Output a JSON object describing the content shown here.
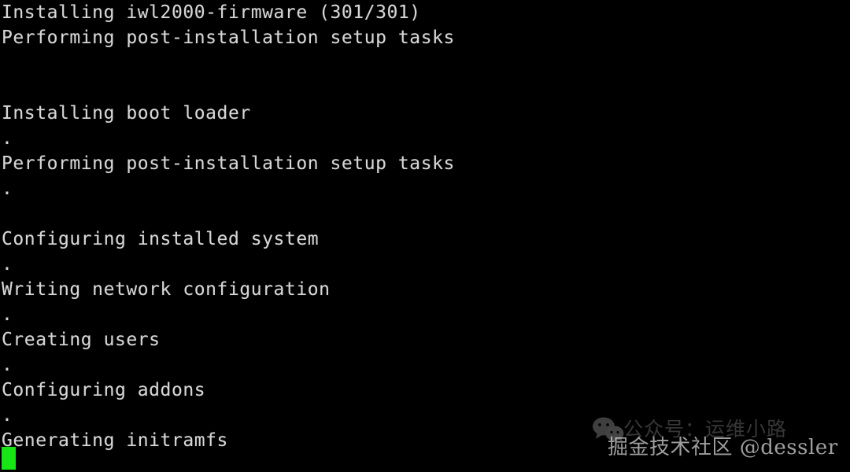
{
  "terminal": {
    "background_color": "#000000",
    "foreground_color": "#d6d6d6",
    "cursor_color": "#16e616",
    "lines": [
      {
        "text": "Installing iwl2000-firmware (301/301)",
        "kind": "text"
      },
      {
        "text": "Performing post-installation setup tasks",
        "kind": "text"
      },
      {
        "text": "",
        "kind": "blank"
      },
      {
        "text": "",
        "kind": "blank"
      },
      {
        "text": "Installing boot loader",
        "kind": "text"
      },
      {
        "text": ".",
        "kind": "dot"
      },
      {
        "text": "Performing post-installation setup tasks",
        "kind": "text"
      },
      {
        "text": ".",
        "kind": "dot"
      },
      {
        "text": "",
        "kind": "blank"
      },
      {
        "text": "Configuring installed system",
        "kind": "text"
      },
      {
        "text": ".",
        "kind": "dot"
      },
      {
        "text": "Writing network configuration",
        "kind": "text"
      },
      {
        "text": ".",
        "kind": "dot"
      },
      {
        "text": "Creating users",
        "kind": "text"
      },
      {
        "text": ".",
        "kind": "dot"
      },
      {
        "text": "Configuring addons",
        "kind": "text"
      },
      {
        "text": ".",
        "kind": "dot"
      },
      {
        "text": "Generating initramfs",
        "kind": "text"
      }
    ],
    "cursor": {
      "visible": true,
      "shape": "block"
    }
  },
  "watermarks": {
    "wechat": {
      "icon": "wechat-logo-icon",
      "text": "公众号：运维小路",
      "color": "#ffffff",
      "opacity": "0.21"
    },
    "juejin": {
      "community": "掘金技术社区",
      "handle": "@dessler",
      "color": "#ffffff",
      "opacity": "0.62"
    }
  }
}
